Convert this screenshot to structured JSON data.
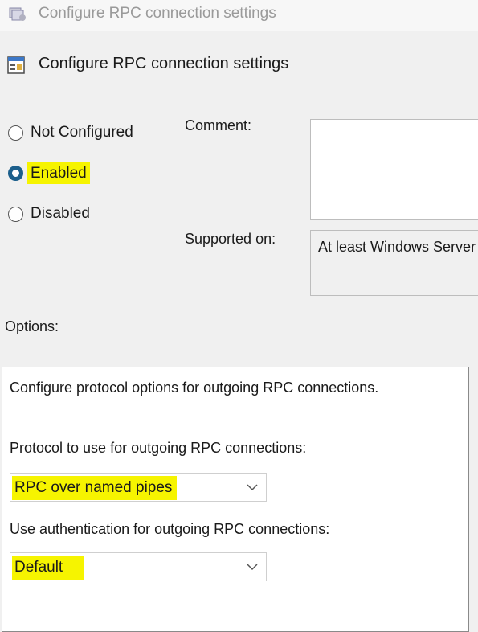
{
  "window": {
    "title": "Configure RPC connection settings",
    "icon": "policy-setting-icon"
  },
  "header": {
    "title": "Configure RPC connection settings",
    "icon": "policy-settings-icon"
  },
  "state": {
    "options": [
      {
        "label": "Not Configured",
        "selected": false
      },
      {
        "label": "Enabled",
        "selected": true,
        "highlighted": true
      },
      {
        "label": "Disabled",
        "selected": false
      }
    ]
  },
  "comment": {
    "label": "Comment:",
    "value": ""
  },
  "supported": {
    "label": "Supported on:",
    "value": "At least Windows Server"
  },
  "options_section": {
    "label": "Options:",
    "description": "Configure protocol options for outgoing RPC connections.",
    "protocol": {
      "label": "Protocol to use for outgoing RPC connections:",
      "selected": "RPC over named pipes"
    },
    "authentication": {
      "label": "Use authentication for outgoing RPC connections:",
      "selected": "Default"
    }
  },
  "colors": {
    "highlight": "#f6f400",
    "radio_checked": "#1c5f8c",
    "background": "#f0f0f0"
  }
}
